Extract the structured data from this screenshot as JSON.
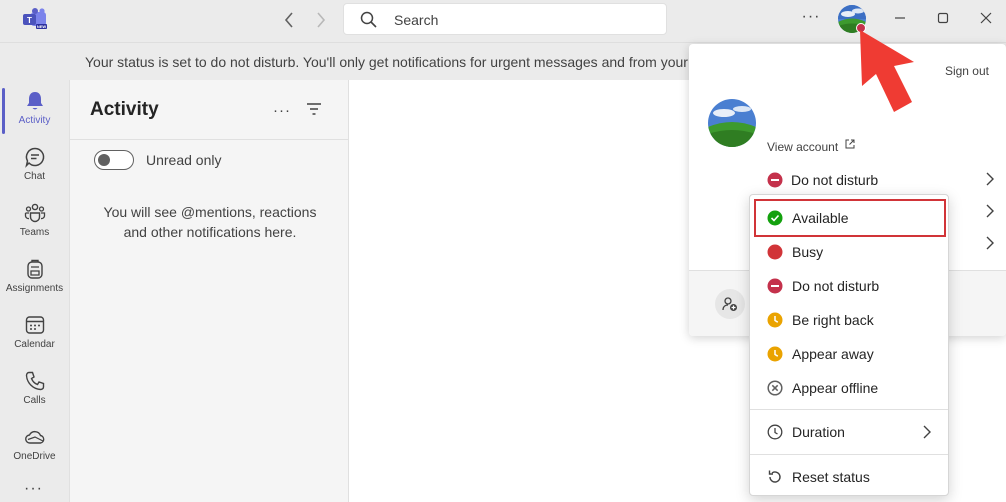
{
  "titlebar": {
    "search_placeholder": "Search",
    "more_label": "···"
  },
  "banner": {
    "text": "Your status is set to do not disturb. You'll only get notifications for urgent messages and from your"
  },
  "rail": {
    "items": [
      {
        "label": "Activity",
        "icon": "bell-icon",
        "active": true
      },
      {
        "label": "Chat",
        "icon": "chat-icon"
      },
      {
        "label": "Teams",
        "icon": "teams-icon"
      },
      {
        "label": "Assignments",
        "icon": "backpack-icon"
      },
      {
        "label": "Calendar",
        "icon": "calendar-icon"
      },
      {
        "label": "Calls",
        "icon": "phone-icon"
      },
      {
        "label": "OneDrive",
        "icon": "cloud-icon"
      }
    ],
    "more_label": "···"
  },
  "activity": {
    "title": "Activity",
    "more_label": "···",
    "toggle_label": "Unread only",
    "empty_message": "You will see @mentions, reactions and other notifications here."
  },
  "profile_card": {
    "sign_out": "Sign out",
    "view_account": "View account",
    "current_status": "Do not disturb"
  },
  "status_menu": {
    "items": [
      {
        "label": "Available",
        "icon": "available-icon",
        "color": "#13a10e"
      },
      {
        "label": "Busy",
        "icon": "busy-icon",
        "color": "#d13438"
      },
      {
        "label": "Do not disturb",
        "icon": "dnd-icon",
        "color": "#c4314b"
      },
      {
        "label": "Be right back",
        "icon": "clock-icon",
        "color": "#eaa300"
      },
      {
        "label": "Appear away",
        "icon": "clock-icon",
        "color": "#eaa300"
      },
      {
        "label": "Appear offline",
        "icon": "offline-icon",
        "color": "#616161"
      }
    ],
    "duration": "Duration",
    "reset": "Reset status"
  },
  "colors": {
    "accent": "#5b5fc7",
    "highlight": "#d13438",
    "annotation_arrow": "#ef3b33"
  }
}
